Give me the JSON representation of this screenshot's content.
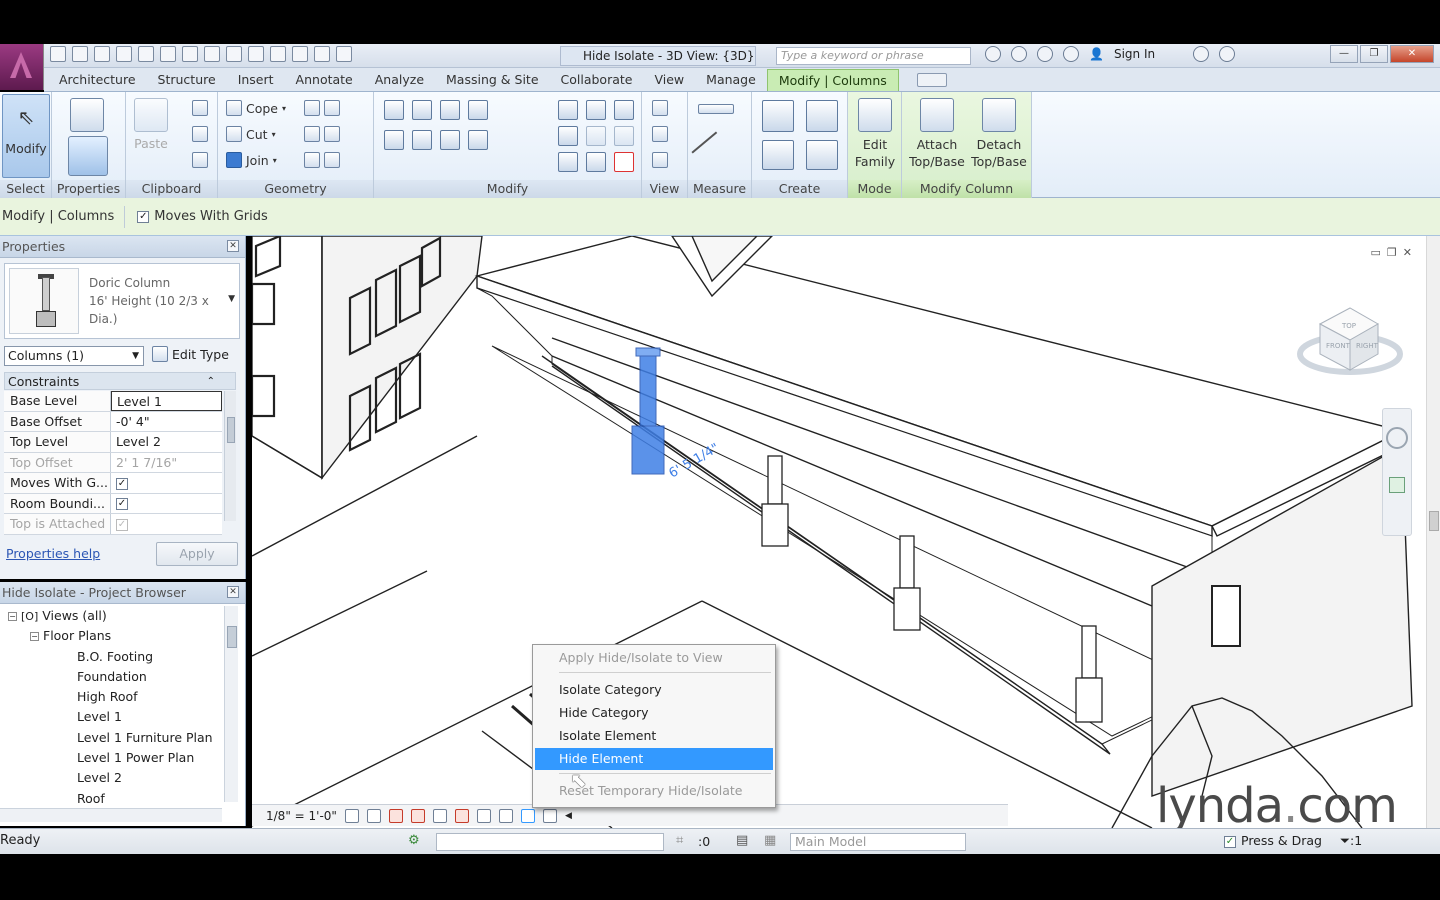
{
  "window": {
    "title": "Hide Isolate - 3D View: {3D}",
    "search_placeholder": "Type a keyword or phrase",
    "sign_in": "Sign In"
  },
  "tabs": [
    {
      "label": "Architecture"
    },
    {
      "label": "Structure"
    },
    {
      "label": "Insert"
    },
    {
      "label": "Annotate"
    },
    {
      "label": "Analyze"
    },
    {
      "label": "Massing & Site"
    },
    {
      "label": "Collaborate"
    },
    {
      "label": "View"
    },
    {
      "label": "Manage"
    },
    {
      "label": "Modify | Columns"
    }
  ],
  "ribbon": {
    "select": {
      "button": "Modify",
      "label": "Select"
    },
    "properties": {
      "label": "Properties"
    },
    "clipboard": {
      "paste": "Paste",
      "label": "Clipboard"
    },
    "geometry": {
      "cope": "Cope",
      "cut": "Cut",
      "join": "Join",
      "label": "Geometry"
    },
    "modify": {
      "label": "Modify"
    },
    "view": {
      "label": "View"
    },
    "measure": {
      "label": "Measure"
    },
    "create": {
      "label": "Create"
    },
    "mode": {
      "edit_family_line1": "Edit",
      "edit_family_line2": "Family",
      "label": "Mode"
    },
    "modify_column": {
      "attach_line1": "Attach",
      "attach_line2": "Top/Base",
      "detach_line1": "Detach",
      "detach_line2": "Top/Base",
      "label": "Modify Column"
    }
  },
  "options_bar": {
    "context": "Modify | Columns",
    "moves_with_grids": "Moves With Grids",
    "moves_with_grids_checked": true
  },
  "properties": {
    "title": "Properties",
    "type_name_line1": "Doric Column",
    "type_name_line2": "16' Height (10 2/3 x",
    "type_name_line3": "Dia.)",
    "instance_filter": "Columns (1)",
    "edit_type": "Edit Type",
    "group": "Constraints",
    "rows": [
      {
        "key": "Base Level",
        "value": "Level 1"
      },
      {
        "key": "Base Offset",
        "value": "-0'  4\""
      },
      {
        "key": "Top Level",
        "value": "Level 2"
      },
      {
        "key": "Top Offset",
        "value": "2'  1 7/16\""
      },
      {
        "key": "Moves With G...",
        "value": "✓"
      },
      {
        "key": "Room Boundi...",
        "value": "✓"
      },
      {
        "key": "Top is Attached",
        "value": "✓"
      }
    ],
    "help_link": "Properties help",
    "apply": "Apply"
  },
  "browser": {
    "title": "Hide Isolate - Project Browser",
    "items": [
      {
        "label": "Views (all)"
      },
      {
        "label": "Floor Plans"
      },
      {
        "label": "B.O. Footing"
      },
      {
        "label": "Foundation"
      },
      {
        "label": "High Roof"
      },
      {
        "label": "Level 1"
      },
      {
        "label": "Level 1 Furniture Plan"
      },
      {
        "label": "Level 1 Power Plan"
      },
      {
        "label": "Level 2"
      },
      {
        "label": "Roof"
      }
    ]
  },
  "viewport": {
    "dimension_text": "6' 5 1/4\"",
    "scale": "1/8\" = 1'-0\"",
    "viewcube_labels": [
      "FRONT",
      "RIGHT",
      "TOP"
    ]
  },
  "context_menu": {
    "items": [
      {
        "label": "Apply Hide/Isolate to View",
        "state": "disabled"
      },
      {
        "label": "Isolate Category",
        "state": "enabled"
      },
      {
        "label": "Hide Category",
        "state": "enabled"
      },
      {
        "label": "Isolate Element",
        "state": "enabled"
      },
      {
        "label": "Hide Element",
        "state": "selected"
      },
      {
        "label": "Reset Temporary Hide/Isolate",
        "state": "disabled"
      }
    ]
  },
  "status_bar": {
    "status": "Ready",
    "worksets_count": ":0",
    "model": "Main Model",
    "press_drag": "Press & Drag",
    "filter_count": ":1"
  },
  "watermark": {
    "brand": "lynda",
    "suffix": "com"
  },
  "colors": {
    "accent_green": "#c9ecb4",
    "selection_blue": "#3399ff",
    "selected_element": "#3f7fe6"
  }
}
